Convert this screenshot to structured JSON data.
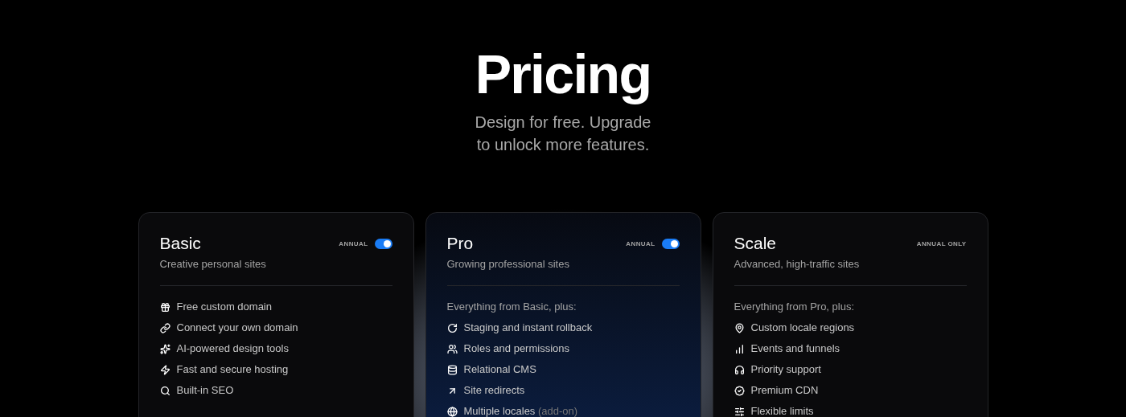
{
  "header": {
    "title": "Pricing",
    "subtitle": "Design for free. Upgrade to unlock more features."
  },
  "plans": [
    {
      "name": "Basic",
      "tagline": "Creative personal sites",
      "billing": {
        "kind": "toggle",
        "label": "ANNUAL",
        "on": true
      },
      "features": [
        {
          "label": "Free custom domain"
        },
        {
          "label": "Connect your own domain"
        },
        {
          "label": "AI-powered design tools"
        },
        {
          "label": "Fast and secure hosting"
        },
        {
          "label": "Built-in SEO"
        }
      ]
    },
    {
      "name": "Pro",
      "tagline": "Growing professional sites",
      "billing": {
        "kind": "toggle",
        "label": "ANNUAL",
        "on": true
      },
      "intro": "Everything from Basic, plus:",
      "features": [
        {
          "label": "Staging and instant rollback"
        },
        {
          "label": "Roles and permissions"
        },
        {
          "label": "Relational CMS"
        },
        {
          "label": "Site redirects"
        },
        {
          "label": "Multiple locales",
          "note": "(add-on)"
        }
      ]
    },
    {
      "name": "Scale",
      "tagline": "Advanced, high-traffic sites",
      "billing": {
        "kind": "label",
        "label": "ANNUAL ONLY"
      },
      "intro": "Everything from Pro, plus:",
      "features": [
        {
          "label": "Custom locale regions"
        },
        {
          "label": "Events and funnels"
        },
        {
          "label": "Priority support"
        },
        {
          "label": "Premium CDN"
        },
        {
          "label": "Flexible limits"
        }
      ]
    }
  ]
}
